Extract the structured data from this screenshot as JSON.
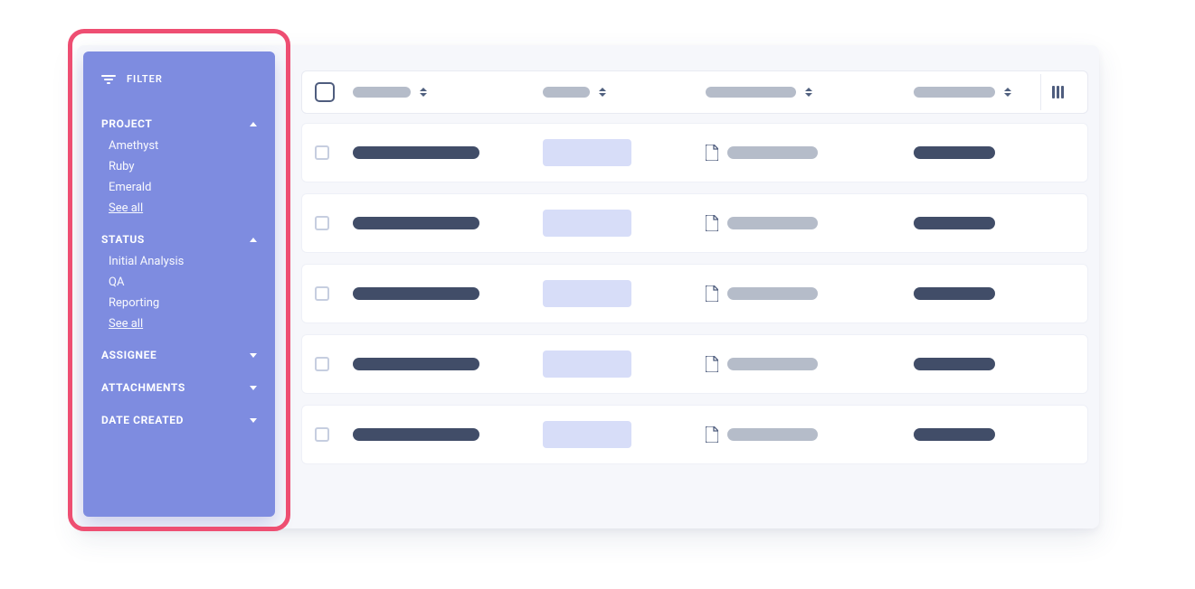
{
  "filter": {
    "header_label": "FILTER",
    "sections": [
      {
        "title": "PROJECT",
        "expanded": true,
        "items": [
          "Amethyst",
          "Ruby",
          "Emerald"
        ],
        "see_all": "See all"
      },
      {
        "title": "STATUS",
        "expanded": true,
        "items": [
          "Initial Analysis",
          "QA",
          "Reporting"
        ],
        "see_all": "See all"
      },
      {
        "title": "ASSIGNEE",
        "expanded": false,
        "items": [],
        "see_all": ""
      },
      {
        "title": "ATTACHMENTS",
        "expanded": false,
        "items": [],
        "see_all": ""
      },
      {
        "title": "DATE CREATED",
        "expanded": false,
        "items": [],
        "see_all": ""
      }
    ]
  },
  "table": {
    "row_count": 5
  },
  "colors": {
    "panel": "#7e8ce0",
    "highlight_border": "#ee4e72",
    "row_bg": "#ffffff",
    "stage_bg": "#f6f7fb",
    "pill_dark": "#414d68",
    "pill_grey": "#b5bcc9",
    "tag_light": "#d7ddf8"
  }
}
